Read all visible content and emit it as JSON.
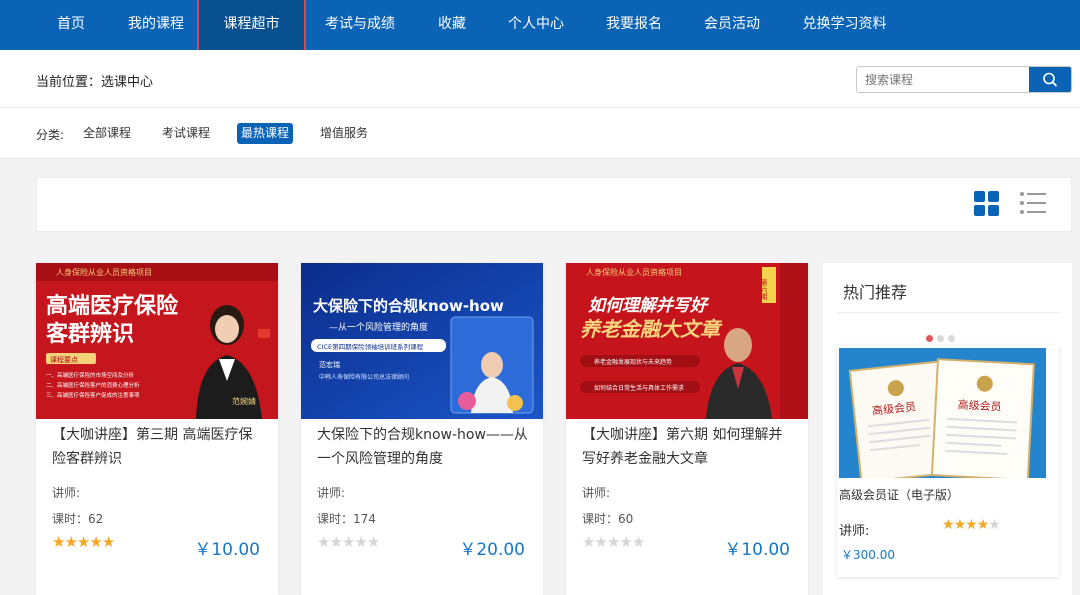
{
  "nav": {
    "items": [
      {
        "label": "首页",
        "active": false
      },
      {
        "label": "我的课程",
        "active": false
      },
      {
        "label": "课程超市",
        "active": true
      },
      {
        "label": "考试与成绩",
        "active": false
      },
      {
        "label": "收藏",
        "active": false
      },
      {
        "label": "个人中心",
        "active": false
      },
      {
        "label": "我要报名",
        "active": false
      },
      {
        "label": "会员活动",
        "active": false
      },
      {
        "label": "兑换学习资料",
        "active": false
      }
    ]
  },
  "breadcrumb": {
    "text": "当前位置：选课中心"
  },
  "search": {
    "placeholder": "搜索课程",
    "value": ""
  },
  "filter": {
    "label": "分类:",
    "options": [
      {
        "label": "全部课程",
        "active": false
      },
      {
        "label": "考试课程",
        "active": false
      },
      {
        "label": "最热课程",
        "active": true
      },
      {
        "label": "增值服务",
        "active": false
      }
    ]
  },
  "view_modes": {
    "grid_icon": "grid-icon",
    "list_icon": "list-icon",
    "selected": "grid"
  },
  "courses": [
    {
      "title": "【大咖讲座】第三期 高端医疗保险客群辨识",
      "lecturer": "讲师:",
      "hours": "课时：62",
      "rating": 5,
      "price": "￥10.00",
      "banner": {
        "header": "人身保险从业人员资格项目",
        "headline1": "高端医疗保险",
        "headline2": "客群辨识",
        "points_title": "课程要点",
        "points": [
          "一、高端医疗保险的市场空间及分析",
          "二、高端医疗保险客户的消费心理分析",
          "三、高端医疗保险客户促成的注意事项"
        ],
        "speaker": "范婉婧"
      }
    },
    {
      "title": "大保险下的合规know-how——从一个风险管理的角度",
      "lecturer": "讲师:",
      "hours": "课时：174",
      "rating": 0,
      "price": "￥20.00",
      "banner": {
        "headline1": "大保险下的合规know-how",
        "headline2": "—从一个风险管理的角度",
        "series": "CICE第四期保险领袖培训班系列课程",
        "speaker": "范宏瑞",
        "company": "中韩人寿保险有限公司总法律顾问"
      }
    },
    {
      "title": "【大咖讲座】第六期 如何理解并写好养老金融大文章",
      "lecturer": "讲师:",
      "hours": "课时：60",
      "rating": 0,
      "price": "￥10.00",
      "banner": {
        "header": "人身保险从业人员资格项目",
        "headline1": "如何理解并写好",
        "headline2": "养老金融大文章",
        "tag": "第六期",
        "point1": "养老金融发展现状与未来趋势",
        "point2": "如何结合日常生活与具体工作需求"
      }
    }
  ],
  "recommend": {
    "title": "热门推荐",
    "item": {
      "title": "高级会员证（电子版）",
      "lecturer": "讲师:",
      "rating": 3.5,
      "price": "￥300.00",
      "cert_heading": "高级会员"
    }
  },
  "colors": {
    "primary": "#0b63b6",
    "star": "#f5a623",
    "price": "#1677c8",
    "highlight": "#e0454e"
  }
}
